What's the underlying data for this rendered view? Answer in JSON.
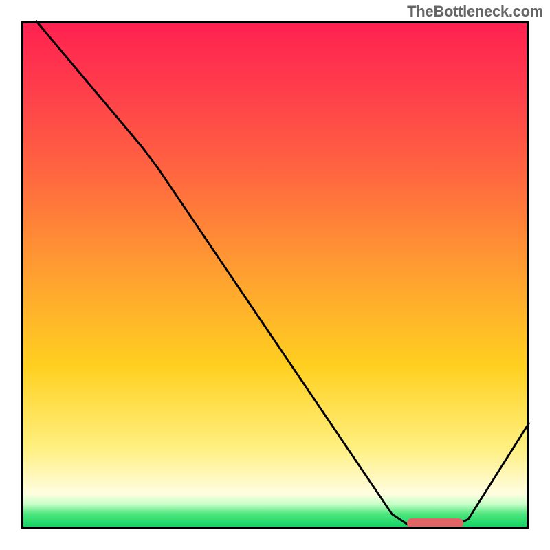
{
  "attribution": "TheBottleneck.com",
  "colors": {
    "curve": "#000000",
    "border": "#000000",
    "optimal_bar": "#e06666"
  },
  "chart_data": {
    "type": "line",
    "title": "",
    "xlabel": "",
    "ylabel": "",
    "x_range": [
      0,
      100
    ],
    "y_range": [
      0,
      100
    ],
    "curve_points": [
      {
        "x": 3,
        "y": 100
      },
      {
        "x": 24,
        "y": 75
      },
      {
        "x": 27,
        "y": 71
      },
      {
        "x": 73,
        "y": 3
      },
      {
        "x": 76,
        "y": 1
      },
      {
        "x": 86,
        "y": 1
      },
      {
        "x": 88,
        "y": 2
      },
      {
        "x": 100,
        "y": 21
      }
    ],
    "optimal_bar": {
      "x_start": 76,
      "x_end": 87,
      "y": 1.2
    },
    "gradient_stops": [
      {
        "pos": 0.0,
        "color": "#ff2050"
      },
      {
        "pos": 0.12,
        "color": "#ff3a4c"
      },
      {
        "pos": 0.3,
        "color": "#ff6640"
      },
      {
        "pos": 0.5,
        "color": "#ffa030"
      },
      {
        "pos": 0.68,
        "color": "#ffd020"
      },
      {
        "pos": 0.84,
        "color": "#fff080"
      },
      {
        "pos": 0.9,
        "color": "#fff8c0"
      },
      {
        "pos": 0.93,
        "color": "#fffde0"
      },
      {
        "pos": 0.95,
        "color": "#c8ffc8"
      },
      {
        "pos": 0.97,
        "color": "#4de67d"
      },
      {
        "pos": 1.0,
        "color": "#08d060"
      }
    ]
  }
}
